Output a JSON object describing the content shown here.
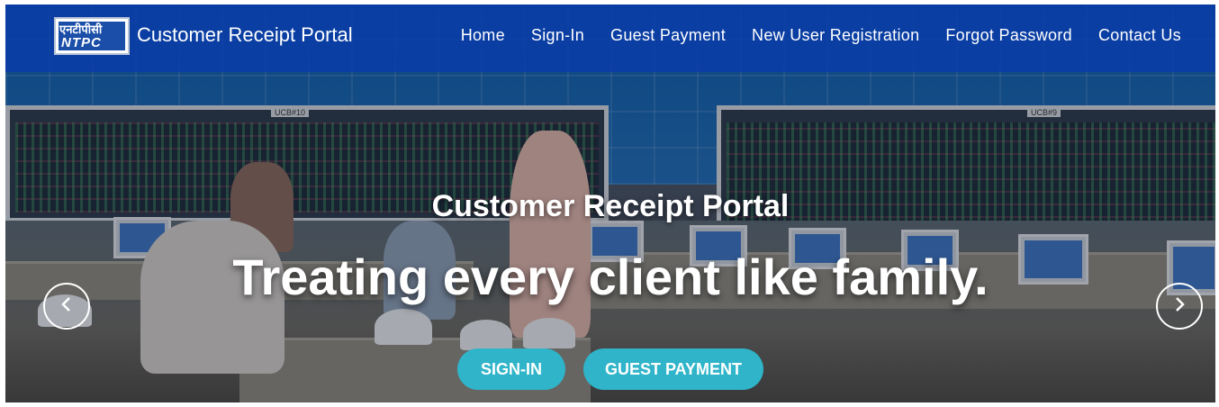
{
  "brand": {
    "logo_devanagari": "एनटीपीसी",
    "logo_text": "NTPC",
    "title": "Customer Receipt Portal"
  },
  "nav": {
    "items": [
      "Home",
      "Sign-In",
      "Guest Payment",
      "New User Registration",
      "Forgot Password",
      "Contact Us"
    ]
  },
  "scene": {
    "panel_left_tag": "UCB#10",
    "panel_right_tag": "UCB#9"
  },
  "hero": {
    "title": "Customer Receipt Portal",
    "subtitle": "Treating every client like family.",
    "buttons": {
      "signin": "SIGN-IN",
      "guest_payment": "GUEST PAYMENT"
    },
    "carousel": {
      "prev_icon": "chevron-left-icon",
      "next_icon": "chevron-right-icon"
    }
  },
  "colors": {
    "navbar": "#0a3caa",
    "button": "#2fb4c9",
    "text": "#ffffff"
  }
}
